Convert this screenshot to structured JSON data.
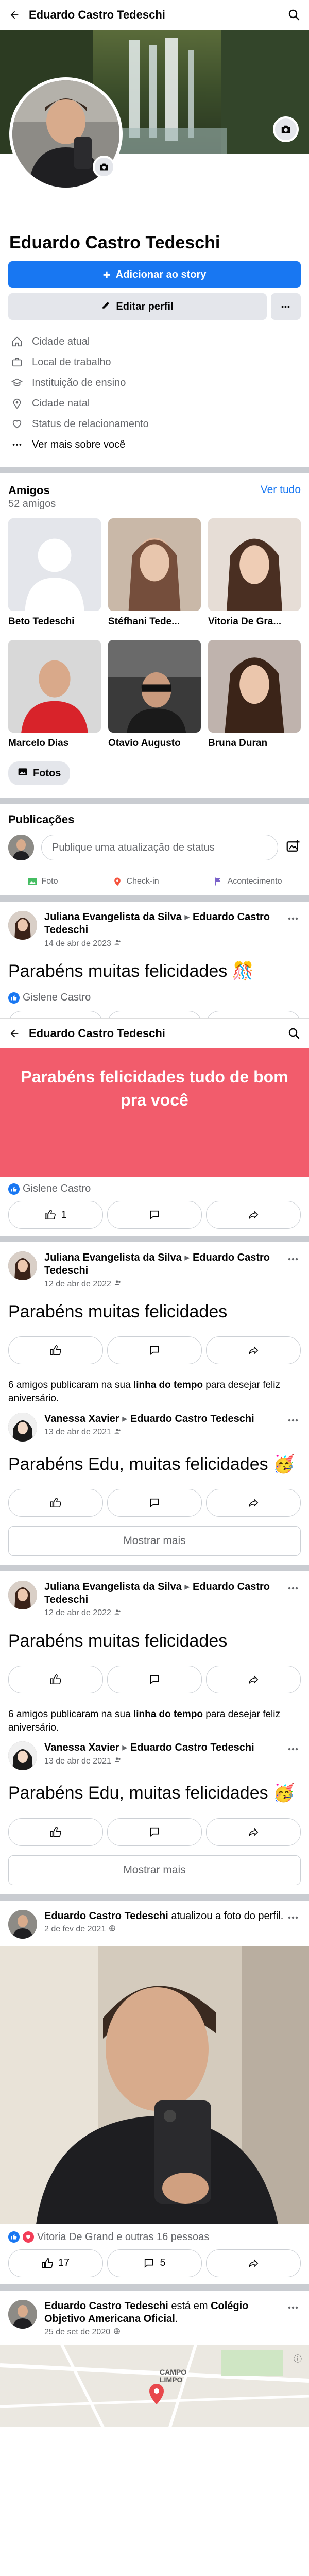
{
  "header": {
    "title": "Eduardo Castro Tedeschi"
  },
  "profile": {
    "name": "Eduardo Castro Tedeschi",
    "add_story_label": "Adicionar ao story",
    "edit_profile_label": "Editar perfil",
    "more_label": "•••"
  },
  "info": [
    {
      "icon": "house-icon",
      "label": "Cidade atual"
    },
    {
      "icon": "briefcase-icon",
      "label": "Local de trabalho"
    },
    {
      "icon": "graduation-cap-icon",
      "label": "Instituição de ensino"
    },
    {
      "icon": "location-pin-icon",
      "label": "Cidade natal"
    },
    {
      "icon": "heart-icon",
      "label": "Status de relacionamento"
    },
    {
      "icon": "ellipsis-icon",
      "label": "Ver mais sobre você"
    }
  ],
  "friends": {
    "title": "Amigos",
    "count": "52 amigos",
    "see_all": "Ver tudo",
    "items": [
      {
        "name": "Beto Tedeschi"
      },
      {
        "name": "Stéfhani Tede..."
      },
      {
        "name": "Vitoria De Gra..."
      },
      {
        "name": "Marcelo Dias"
      },
      {
        "name": "Otavio Augusto"
      },
      {
        "name": "Bruna Duran"
      }
    ],
    "photos_label": "Fotos"
  },
  "publications": {
    "title": "Publicações",
    "composer_placeholder": "Publique uma atualização de status",
    "actions": [
      "Foto",
      "Check-in",
      "Acontecimento"
    ]
  },
  "header2": {
    "title": "Eduardo Castro Tedeschi"
  },
  "posts": [
    {
      "author": "Juliana Evangelista da Silva",
      "target": "Eduardo Castro Tedeschi",
      "date": "14 de abr de 2023",
      "text": "Parabéns muitas felicidades 🎊",
      "reactions": "Gislene Castro"
    },
    {
      "banner_text": "Parabéns felicidades tudo de bom pra você",
      "reactions": "Gislene Castro",
      "like_count": "1"
    },
    {
      "author": "Juliana Evangelista da Silva",
      "target": "Eduardo Castro Tedeschi",
      "date": "12 de abr de 2022",
      "text": "Parabéns muitas felicidades"
    },
    {
      "notice_pre": "6 amigos publicaram na sua ",
      "notice_bold": "linha do tempo",
      "notice_post": " para desejar feliz aniversário.",
      "author": "Vanessa Xavier",
      "target": "Eduardo Castro Tedeschi",
      "date": "13 de abr de 2021",
      "text": "Parabéns Edu, muitas felicidades 🥳",
      "show_more": "Mostrar mais"
    },
    {
      "author": "Juliana Evangelista da Silva",
      "target": "Eduardo Castro Tedeschi",
      "date": "12 de abr de 2022",
      "text": "Parabéns muitas felicidades"
    },
    {
      "notice_pre": "6 amigos publicaram na sua ",
      "notice_bold": "linha do tempo",
      "notice_post": " para desejar feliz aniversário.",
      "author": "Vanessa Xavier",
      "target": "Eduardo Castro Tedeschi",
      "date": "13 de abr de 2021",
      "text": "Parabéns Edu, muitas felicidades 🥳",
      "show_more": "Mostrar mais"
    },
    {
      "author": "Eduardo Castro Tedeschi",
      "action": " atualizou a foto do perfil.",
      "date": "2 de fev de 2021",
      "reactions": "Vitoria De Grand e outras 16 pessoas",
      "like_count": "17",
      "comment_count": "5"
    },
    {
      "author": "Eduardo Castro Tedeschi",
      "action_pre": " está em ",
      "place": "Colégio Objetivo Americana Oficial",
      "action_post": ".",
      "date": "25 de set de 2020",
      "map_label": "CAMPO LIMPO"
    }
  ],
  "colors": {
    "accent": "#1877f2",
    "banner": "#f25c6c"
  }
}
